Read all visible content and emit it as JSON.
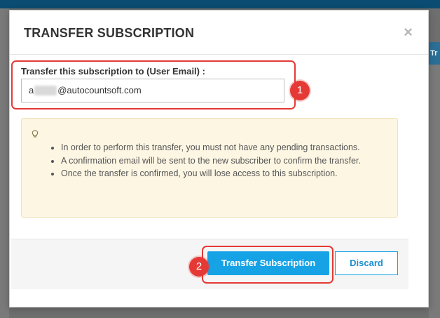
{
  "page": {
    "background_tab_text": "Tr"
  },
  "modal": {
    "title": "TRANSFER SUBSCRIPTION",
    "close_symbol": "×",
    "field_label": "Transfer this subscription to (User Email) :",
    "email_value_prefix": "a",
    "email_value_suffix": "@autocountsoft.com",
    "note_icon": "lightbulb-icon",
    "notes": [
      "In order to perform this transfer, you must not have any pending transactions.",
      "A confirmation email will be sent to the new subscriber to confirm the transfer.",
      "Once the transfer is confirmed, you will lose access to this subscription."
    ],
    "primary_button": "Transfer Subscription",
    "discard_button": "Discard"
  },
  "annotations": {
    "marker_1": "1",
    "marker_2": "2"
  },
  "colors": {
    "accent": "#16a3e6",
    "highlight": "#e53935",
    "note_background": "#fdf6e3"
  }
}
